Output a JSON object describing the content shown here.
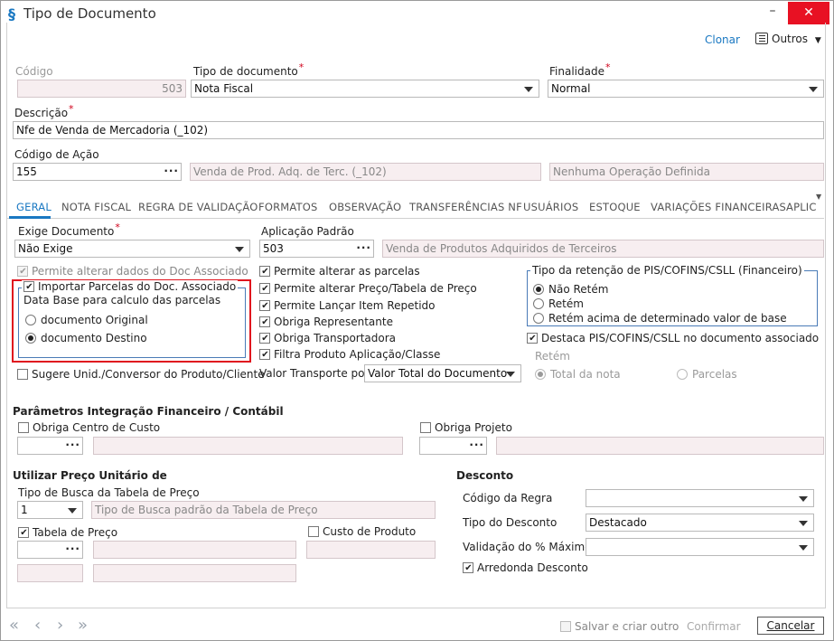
{
  "window": {
    "title": "Tipo de Documento"
  },
  "toolbar": {
    "clear": "Clonar",
    "more": "Outros"
  },
  "header": {
    "codigo_label": "Código",
    "codigo_value": "503",
    "tipo_label": "Tipo de documento",
    "tipo_value": "Nota Fiscal",
    "finalidade_label": "Finalidade",
    "finalidade_value": "Normal",
    "descricao_label": "Descrição",
    "descricao_value": "Nfe de Venda de Mercadoria (_102)",
    "acao_label": "Código de Ação",
    "acao_value": "155",
    "acao_desc": "Venda de Prod. Adq. de Terc. (_102)",
    "operacao": "Nenhuma Operação Definida"
  },
  "tabs": [
    "GERAL",
    "NOTA FISCAL",
    "REGRA DE VALIDAÇÃO",
    "FORMATOS",
    "OBSERVAÇÃO",
    "TRANSFERÊNCIAS NF",
    "USUÁRIOS",
    "ESTOQUE",
    "VARIAÇÕES FINANCEIRAS",
    "APLIC"
  ],
  "geral": {
    "exige_label": "Exige Documento",
    "exige_value": "Não Exige",
    "aplic_label": "Aplicação Padrão",
    "aplic_value": "503",
    "aplic_desc": "Venda de Produtos Adquiridos de Terceiros",
    "permite_doc_assoc": "Permite alterar dados do Doc Associado",
    "importar": "Importar Parcelas do Doc. Associado",
    "data_base": "Data Base para calculo das parcelas",
    "doc_original": "documento Original",
    "doc_destino": "documento Destino",
    "sugere": "Sugere Unid./Conversor do Produto/Cliente",
    "checks": [
      "Permite alterar as parcelas",
      "Permite alterar Preço/Tabela de Preço",
      "Permite Lançar Item Repetido",
      "Obriga Representante",
      "Obriga Transportadora",
      "Filtra Produto Aplicação/Classe"
    ],
    "valor_transp_label": "Valor Transporte por",
    "valor_transp_value": "Valor Total do Documento",
    "ret_group": "Tipo da retenção de PIS/COFINS/CSLL (Financeiro)",
    "ret_options": [
      "Não Retém",
      "Retém",
      "Retém acima de determinado valor de base"
    ],
    "destaca": "Destaca PIS/COFINS/CSLL no documento associado",
    "retem_label": "Retém",
    "total_nota": "Total da nota",
    "parcelas": "Parcelas"
  },
  "financeiro": {
    "title": "Parâmetros Integração Financeiro / Contábil",
    "centro_custo": "Obriga Centro de Custo",
    "projeto": "Obriga Projeto"
  },
  "preco": {
    "title": "Utilizar Preço Unitário de",
    "busca_label": "Tipo de Busca da Tabela de Preço",
    "busca_value": "1",
    "busca_desc": "Tipo de Busca padrão da Tabela de Preço",
    "tabela": "Tabela de Preço",
    "custo": "Custo de Produto"
  },
  "desconto": {
    "title": "Desconto",
    "regra_label": "Código da Regra",
    "tipo_label": "Tipo do Desconto",
    "tipo_value": "Destacado",
    "validacao_label": "Validação do % Máximo",
    "arredonda": "Arredonda Desconto"
  },
  "footer": {
    "salvar": "Salvar e criar outro",
    "confirmar": "Confirmar",
    "cancelar": "Cancelar"
  },
  "colors": {
    "accent": "#1a78c2",
    "highlight": "#e0141e",
    "tab_active": "#1a78c2"
  }
}
